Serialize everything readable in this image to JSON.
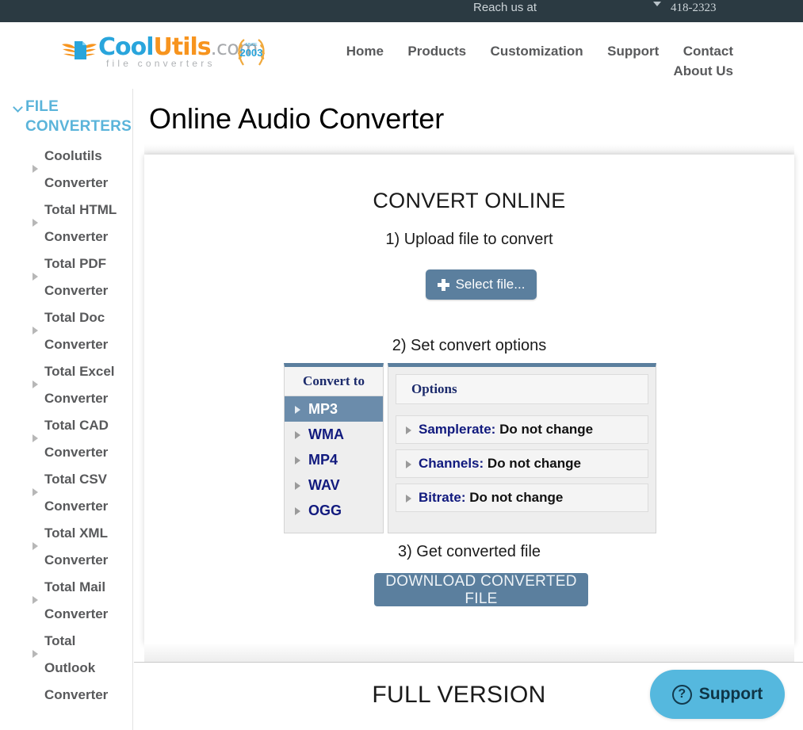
{
  "topbar": {
    "reach_label": "Reach us at",
    "caret_icon": "caret-down-icon",
    "phone": "418-2323"
  },
  "masthead": {
    "logo": {
      "part_cool": "Cool",
      "part_utils": "Utils",
      "part_com": ".com",
      "tagline": "file converters",
      "badge_since": "SINCE",
      "badge_year": "2003",
      "wing_icon": "winged-document-icon"
    },
    "nav_row1": [
      "Home",
      "Products",
      "Customization",
      "Support",
      "Contact"
    ],
    "nav_row2": [
      "About Us"
    ]
  },
  "sidebar": {
    "header": "FILE CONVERTERS",
    "header_icon": "chevron-down-icon",
    "items": [
      {
        "label": "Coolutils Converter",
        "arrow_icon": "caret-right-icon"
      },
      {
        "label": "Total HTML Converter",
        "arrow_icon": "caret-right-icon"
      },
      {
        "label": "Total PDF Converter",
        "arrow_icon": "caret-right-icon"
      },
      {
        "label": "Total Doc Converter",
        "arrow_icon": "caret-right-icon"
      },
      {
        "label": "Total Excel Converter",
        "arrow_icon": "caret-right-icon"
      },
      {
        "label": "Total CAD Converter",
        "arrow_icon": "caret-right-icon"
      },
      {
        "label": "Total CSV Converter",
        "arrow_icon": "caret-right-icon"
      },
      {
        "label": "Total XML Converter",
        "arrow_icon": "caret-right-icon"
      },
      {
        "label": "Total Mail Converter",
        "arrow_icon": "caret-right-icon"
      },
      {
        "label": "Total Outlook Converter",
        "arrow_icon": "caret-right-icon"
      }
    ]
  },
  "main": {
    "page_title": "Online Audio Converter",
    "card": {
      "convert_title": "CONVERT ONLINE",
      "step1": "1) Upload file to convert",
      "select_file_button": "Select file...",
      "select_file_icon": "plus-icon",
      "step2": "2) Set convert options",
      "convert_to_header": "Convert to",
      "formats": [
        {
          "label": "MP3",
          "selected": true
        },
        {
          "label": "WMA",
          "selected": false
        },
        {
          "label": "MP4",
          "selected": false
        },
        {
          "label": "WAV",
          "selected": false
        },
        {
          "label": "OGG",
          "selected": false
        }
      ],
      "options_header": "Options",
      "options": [
        {
          "name": "Samplerate:",
          "value": "Do not change"
        },
        {
          "name": "Channels:",
          "value": "Do not change"
        },
        {
          "name": "Bitrate:",
          "value": "Do not change"
        }
      ],
      "step3": "3) Get converted file",
      "download_button": "DOWNLOAD CONVERTED FILE"
    },
    "full_version": "FULL VERSION"
  },
  "support_widget": {
    "label": "Support",
    "icon": "question-circle-icon"
  },
  "colors": {
    "topbar_bg": "#2b3a42",
    "logo_blue": "#29a5dc",
    "logo_orange": "#f7941e",
    "sidebar_heading": "#5bb4da",
    "button_blue": "#5b7f9e",
    "selected_row": "#6b8cab",
    "option_label": "#111a7e",
    "support_blue": "#55b8de"
  }
}
